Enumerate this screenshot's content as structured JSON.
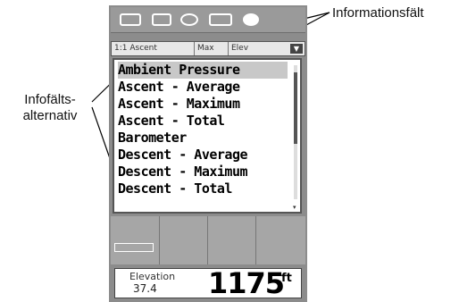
{
  "callouts": {
    "info_field": "Informationsfält",
    "info_options": "Infofälts-\nalternativ"
  },
  "field_row": {
    "cell_1": "1:1 Ascent",
    "cell_2": "Max",
    "cell_3": "Elev",
    "dropdown_glyph": "▼"
  },
  "options_list": [
    {
      "label": "Ambient Pressure",
      "selected": true
    },
    {
      "label": "Ascent - Average",
      "selected": false
    },
    {
      "label": "Ascent - Maximum",
      "selected": false
    },
    {
      "label": "Ascent - Total",
      "selected": false
    },
    {
      "label": "Barometer",
      "selected": false
    },
    {
      "label": "Descent - Average",
      "selected": false
    },
    {
      "label": "Descent - Maximum",
      "selected": false
    },
    {
      "label": "Descent - Total",
      "selected": false
    }
  ],
  "scrollbar": {
    "arrow_glyph": "▾"
  },
  "bottom_field": {
    "label": "Elevation",
    "small_value": "37.4",
    "value": "1175",
    "unit": "ft"
  },
  "colors": {
    "device_body": "#8c8c8c",
    "selected_row": "#c8c8c8",
    "list_background": "#ffffff"
  }
}
